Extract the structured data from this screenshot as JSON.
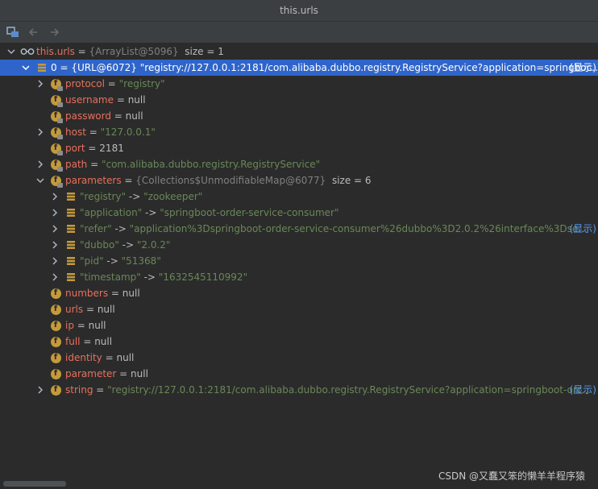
{
  "window": {
    "title": "this.urls"
  },
  "toolbar": {
    "items": [
      "restore-layout-icon",
      "back-icon",
      "forward-icon"
    ]
  },
  "tree": {
    "root": {
      "name": "this.urls",
      "eq": " = ",
      "ref": "{ArrayList@5096}",
      "size": "size = 1"
    },
    "item0": {
      "prefix": "0 = ",
      "ref": "{URL@6072}",
      "value": "\"registry://127.0.0.1:2181/com.alibaba.dubbo.registry.RegistryService?application=springboc...",
      "show": "(显示)"
    },
    "fields": [
      {
        "name": "protocol",
        "eq": " = ",
        "value": "\"registry\""
      },
      {
        "name": "username",
        "eq": " = ",
        "value": "null"
      },
      {
        "name": "password",
        "eq": " = ",
        "value": "null"
      },
      {
        "name": "host",
        "eq": " = ",
        "value": "\"127.0.0.1\""
      },
      {
        "name": "port",
        "eq": " = ",
        "value": "2181"
      },
      {
        "name": "path",
        "eq": " = ",
        "value": "\"com.alibaba.dubbo.registry.RegistryService\""
      },
      {
        "name": "parameters",
        "eq": " = ",
        "ref": "{Collections$UnmodifiableMap@6077}",
        "size": "size = 6"
      }
    ],
    "entries": [
      {
        "key": "\"registry\"",
        "arrow": " -> ",
        "value": "\"zookeeper\""
      },
      {
        "key": "\"application\"",
        "arrow": " -> ",
        "value": "\"springboot-order-service-consumer\""
      },
      {
        "key": "\"refer\"",
        "arrow": " -> ",
        "value": "\"application%3Dspringboot-order-service-consumer%26dubbo%3D2.0.2%26interface%3Dse...",
        "show": "(显示)"
      },
      {
        "key": "\"dubbo\"",
        "arrow": " -> ",
        "value": "\"2.0.2\""
      },
      {
        "key": "\"pid\"",
        "arrow": " -> ",
        "value": "\"51368\""
      },
      {
        "key": "\"timestamp\"",
        "arrow": " -> ",
        "value": "\"1632545110992\""
      }
    ],
    "more_fields": [
      {
        "name": "numbers",
        "eq": " = ",
        "value": "null"
      },
      {
        "name": "urls",
        "eq": " = ",
        "value": "null"
      },
      {
        "name": "ip",
        "eq": " = ",
        "value": "null"
      },
      {
        "name": "full",
        "eq": " = ",
        "value": "null"
      },
      {
        "name": "identity",
        "eq": " = ",
        "value": "null"
      },
      {
        "name": "parameter",
        "eq": " = ",
        "value": "null"
      },
      {
        "name": "string",
        "eq": " = ",
        "value": "\"registry://127.0.0.1:2181/com.alibaba.dubbo.registry.RegistryService?application=springboot-orc...",
        "show": "(显示)"
      }
    ]
  },
  "watermark": "CSDN @又蠢又笨的懒羊羊程序猿",
  "colors": {
    "background": "#2b2b2b",
    "selection": "#2f65ca",
    "field_name": "#e8705d",
    "string_value": "#6a8759",
    "reference": "#808080",
    "field_icon": "#c49a3c",
    "link": "#589df6"
  }
}
